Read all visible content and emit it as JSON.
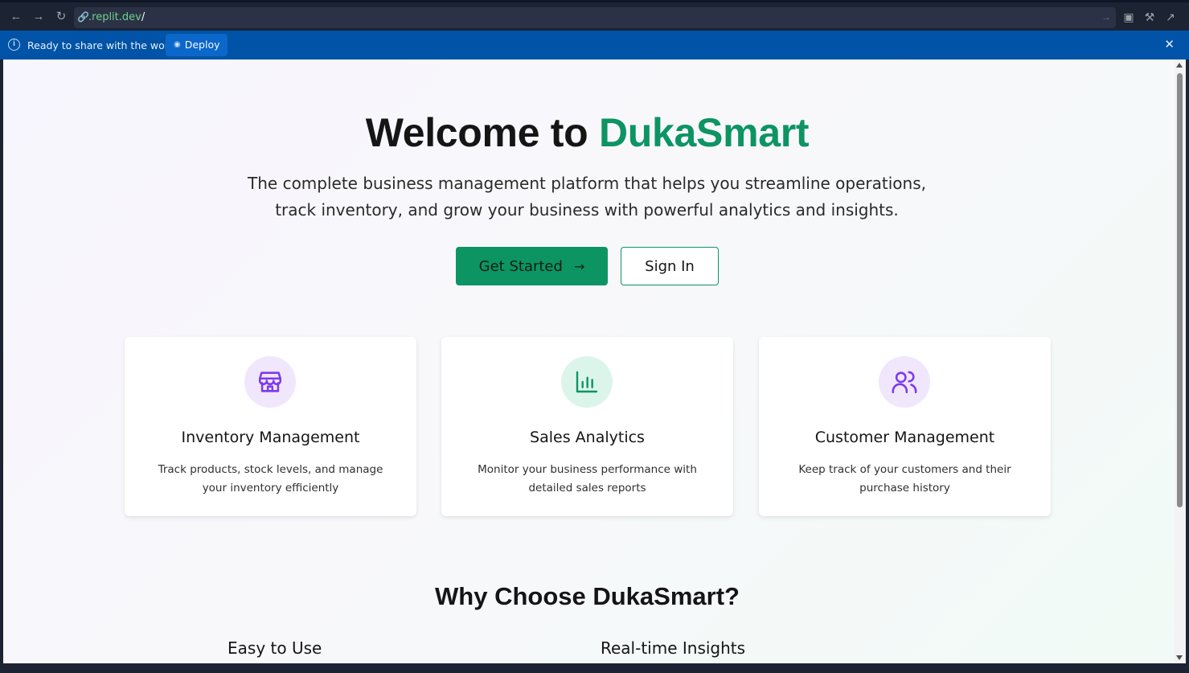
{
  "browser": {
    "url_host": ".replit.dev",
    "url_path": "/",
    "back_icon": "arrow-left-icon",
    "forward_icon": "arrow-right-icon",
    "reload_icon": "reload-icon"
  },
  "banner": {
    "message": "Ready to share with the world?",
    "deploy_label": "Deploy"
  },
  "hero": {
    "title_prefix": "Welcome to ",
    "title_brand": "DukaSmart",
    "subtitle": "The complete business management platform that helps you streamline operations, track inventory, and grow your business with powerful analytics and insights.",
    "primary_button": "Get Started",
    "secondary_button": "Sign In"
  },
  "features": [
    {
      "title": "Inventory Management",
      "description": "Track products, stock levels, and manage your inventory efficiently",
      "icon": "store-icon",
      "color": "#7c3aed",
      "bg": "#f1e7fd"
    },
    {
      "title": "Sales Analytics",
      "description": "Monitor your business performance with detailed sales reports",
      "icon": "bar-chart-icon",
      "color": "#0d9463",
      "bg": "#dcf5ea"
    },
    {
      "title": "Customer Management",
      "description": "Keep track of your customers and their purchase history",
      "icon": "users-icon",
      "color": "#7c3aed",
      "bg": "#f1e7fd"
    }
  ],
  "why": {
    "title": "Why Choose DukaSmart?",
    "items": [
      "Easy to Use",
      "Real-time Insights"
    ]
  },
  "colors": {
    "brand_green": "#0d9463",
    "accent_purple": "#7c3aed",
    "banner_blue": "#0053a6"
  }
}
